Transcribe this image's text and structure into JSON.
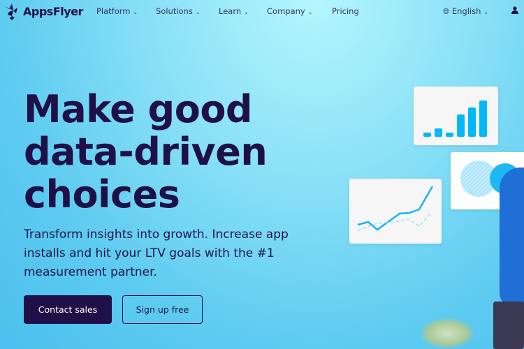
{
  "nav": {
    "brand": "AppsFlyer",
    "items": [
      {
        "label": "Platform"
      },
      {
        "label": "Solutions"
      },
      {
        "label": "Learn"
      },
      {
        "label": "Company"
      },
      {
        "label": "Pricing"
      }
    ],
    "language": "English"
  },
  "hero": {
    "title_lines": [
      "Make good",
      "data-driven",
      "choices"
    ],
    "subtitle": "Transform insights into growth. Increase app installs and hit your LTV goals with the #1 measurement partner.",
    "primary_button": "Contact sales",
    "secondary_button": "Sign up free"
  },
  "colors": {
    "text": "#1f1147",
    "accent": "#00b8f5"
  }
}
